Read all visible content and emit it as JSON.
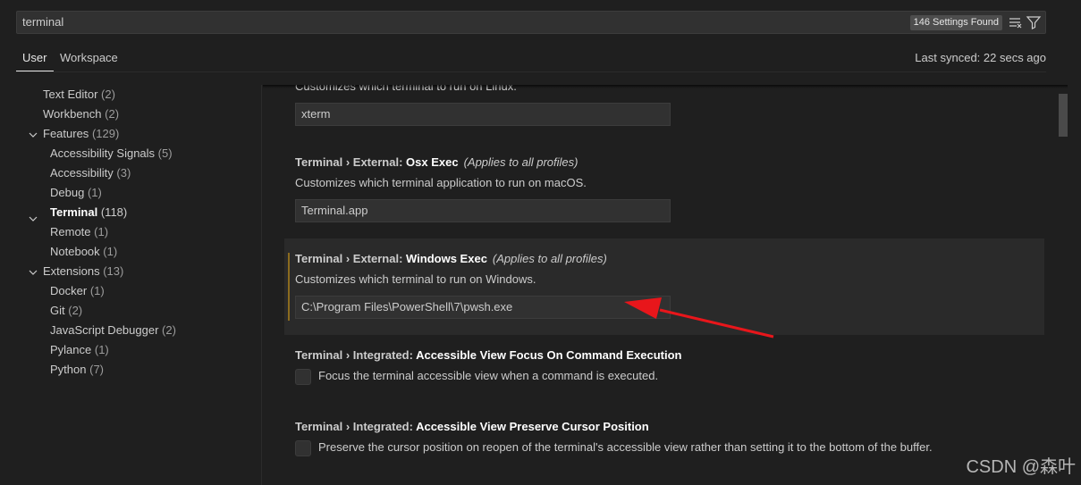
{
  "search": {
    "value": "terminal",
    "results_badge": "146 Settings Found"
  },
  "tabs": {
    "user": "User",
    "workspace": "Workspace",
    "last_synced": "Last synced: 22 secs ago"
  },
  "toc": [
    {
      "label": "Text Editor",
      "count": "(2)"
    },
    {
      "label": "Workbench",
      "count": "(2)"
    },
    {
      "label": "Features",
      "count": "(129)"
    },
    {
      "label": "Accessibility Signals",
      "count": "(5)"
    },
    {
      "label": "Accessibility",
      "count": "(3)"
    },
    {
      "label": "Debug",
      "count": "(1)"
    },
    {
      "label": "Terminal",
      "count": "(118)"
    },
    {
      "label": "Remote",
      "count": "(1)"
    },
    {
      "label": "Notebook",
      "count": "(1)"
    },
    {
      "label": "Extensions",
      "count": "(13)"
    },
    {
      "label": "Docker",
      "count": "(1)"
    },
    {
      "label": "Git",
      "count": "(2)"
    },
    {
      "label": "JavaScript Debugger",
      "count": "(2)"
    },
    {
      "label": "Pylance",
      "count": "(1)"
    },
    {
      "label": "Python",
      "count": "(7)"
    }
  ],
  "settings": {
    "linux": {
      "desc": "Customizes which terminal to run on Linux.",
      "value": "xterm"
    },
    "osx": {
      "category": "Terminal › External: ",
      "name": "Osx Exec",
      "scope": "(Applies to all profiles)",
      "desc": "Customizes which terminal application to run on macOS.",
      "value": "Terminal.app"
    },
    "windows": {
      "category": "Terminal › External: ",
      "name": "Windows Exec",
      "scope": "(Applies to all profiles)",
      "desc": "Customizes which terminal to run on Windows.",
      "value": "C:\\Program Files\\PowerShell\\7\\pwsh.exe"
    },
    "focus_cmd": {
      "category": "Terminal › Integrated: ",
      "name": "Accessible View Focus On Command Execution",
      "desc": "Focus the terminal accessible view when a command is executed."
    },
    "preserve_cursor": {
      "category": "Terminal › Integrated: ",
      "name": "Accessible View Preserve Cursor Position",
      "desc": "Preserve the cursor position on reopen of the terminal's accessible view rather than setting it to the bottom of the buffer."
    }
  },
  "colors": {
    "annotation_arrow": "#e8161b",
    "focus_indicator": "#8b6b1f"
  },
  "watermark": "CSDN @森叶"
}
